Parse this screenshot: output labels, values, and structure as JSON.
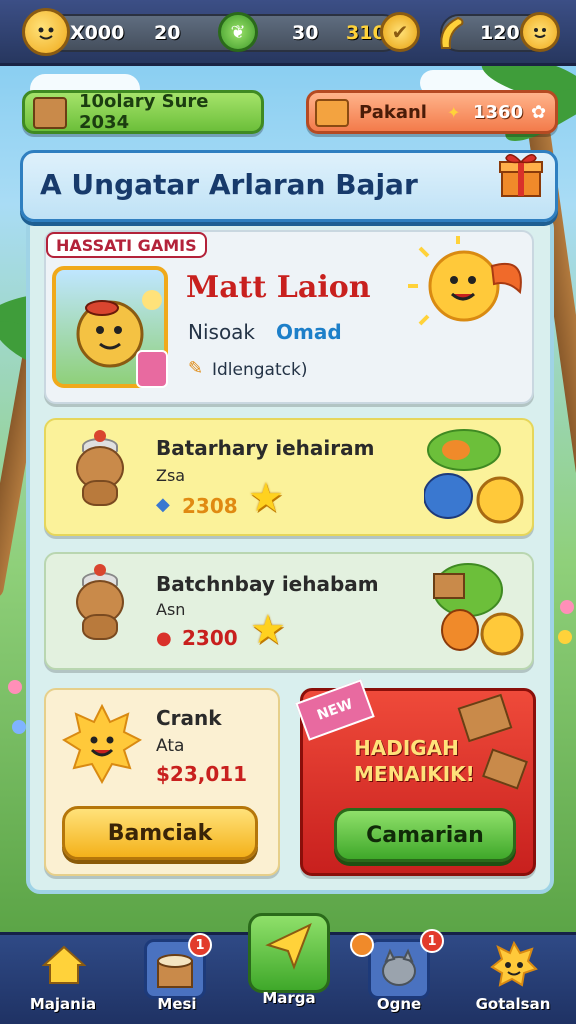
{
  "topbar": {
    "resources": [
      {
        "label": "X000",
        "icon": "pet-avatar-icon"
      },
      {
        "label": "20",
        "icon": ""
      },
      {
        "label": "30",
        "icon": "leaf-coin-icon"
      },
      {
        "label": "310",
        "icon": "gold-coin-icon"
      },
      {
        "label": "120",
        "icon": "banana-icon"
      }
    ],
    "end_icon": "coin-face-icon"
  },
  "subheader": {
    "left_label": "10olary Sure 2034",
    "right_label": "Pakanl",
    "right_value": "1360"
  },
  "title": "A Ungatar Arlaran Bajar",
  "profile": {
    "tag": "HASSATI GAMIS",
    "name": "Matt Laion",
    "subtitle_a": "Nisoak",
    "subtitle_b": "Omad",
    "status": "Idlengatck)"
  },
  "cards": [
    {
      "title": "Batarhary iehairam",
      "sub": "Zsa",
      "price": "2308",
      "bg": "#fbf29a"
    },
    {
      "title": "Batchnbay iehabam",
      "sub": "Asn",
      "price": "2300",
      "bg": "#e3f1df"
    }
  ],
  "bottom_left": {
    "title": "Crank",
    "sub": "Ata",
    "price": "$23,011",
    "button": "Bamciak"
  },
  "promo": {
    "ribbon": "NEW",
    "line1": "HADIGAH",
    "line2": "MENAIKIK!",
    "button": "Camarian"
  },
  "nav": [
    {
      "label": "Majania",
      "icon": "home-icon",
      "badge": ""
    },
    {
      "label": "Mesi",
      "icon": "basket-icon",
      "badge": "1"
    },
    {
      "label": "Marga",
      "icon": "paper-plane-icon",
      "badge": ""
    },
    {
      "label": "Ogne",
      "icon": "cat-icon",
      "badge": "1"
    },
    {
      "label": "Gotalsan",
      "icon": "pet-face-icon",
      "badge": ""
    }
  ],
  "colors": {
    "accent_blue": "#2f7fc0",
    "promo_red": "#d9312a",
    "button_yellow": "#ffd23a",
    "button_green": "#4cbb3a",
    "name_red": "#c8201e"
  }
}
